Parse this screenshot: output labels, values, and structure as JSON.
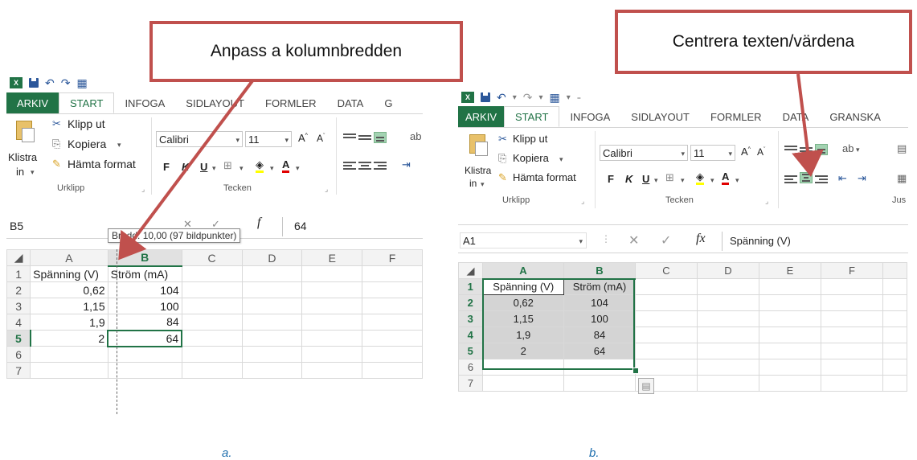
{
  "panel_a": {
    "tabs": [
      "ARKIV",
      "START",
      "INFOGA",
      "SIDLAYOUT",
      "FORMLER",
      "DATA",
      "G"
    ],
    "active_tab": "START",
    "clipboard": {
      "paste": "Klistra",
      "paste_sub": "in",
      "cut": "Klipp ut",
      "copy": "Kopiera",
      "format_painter": "Hämta format",
      "group": "Urklipp"
    },
    "font": {
      "name": "Calibri",
      "size": "11",
      "bold": "F",
      "italic": "K",
      "underline": "U",
      "group": "Tecken"
    },
    "name_box": "B5",
    "formula_value": "64",
    "tooltip": "Bredd: 10,00 (97 bildpunkter)",
    "columns": [
      "A",
      "B",
      "C",
      "D",
      "E",
      "F"
    ],
    "rows": [
      {
        "n": "1",
        "a": "Spänning (V)",
        "b": "Ström (mA)"
      },
      {
        "n": "2",
        "a": "0,62",
        "b": "104"
      },
      {
        "n": "3",
        "a": "1,15",
        "b": "100"
      },
      {
        "n": "4",
        "a": "1,9",
        "b": "84"
      },
      {
        "n": "5",
        "a": "2",
        "b": "64"
      },
      {
        "n": "6",
        "a": "",
        "b": ""
      },
      {
        "n": "7",
        "a": "",
        "b": ""
      }
    ],
    "callout": "Anpass a kolumnbredden",
    "caption": "a."
  },
  "panel_b": {
    "tabs": [
      "ARKIV",
      "START",
      "INFOGA",
      "SIDLAYOUT",
      "FORMLER",
      "DATA",
      "GRANSKA"
    ],
    "active_tab": "START",
    "clipboard": {
      "paste": "Klistra",
      "paste_sub": "in",
      "cut": "Klipp ut",
      "copy": "Kopiera",
      "format_painter": "Hämta format",
      "group": "Urklipp"
    },
    "font": {
      "name": "Calibri",
      "size": "11",
      "bold": "F",
      "italic": "K",
      "underline": "U",
      "group": "Tecken"
    },
    "align_group": "Jus",
    "name_box": "A1",
    "fx": "fx",
    "formula_value": "Spänning (V)",
    "columns": [
      "A",
      "B",
      "C",
      "D",
      "E",
      "F"
    ],
    "rows": [
      {
        "n": "1",
        "a": "Spänning (V)",
        "b": "Ström (mA)"
      },
      {
        "n": "2",
        "a": "0,62",
        "b": "104"
      },
      {
        "n": "3",
        "a": "1,15",
        "b": "100"
      },
      {
        "n": "4",
        "a": "1,9",
        "b": "84"
      },
      {
        "n": "5",
        "a": "2",
        "b": "64"
      },
      {
        "n": "6",
        "a": "",
        "b": ""
      },
      {
        "n": "7",
        "a": "",
        "b": ""
      }
    ],
    "callout": "Centrera texten/värdena",
    "caption": "b."
  },
  "colors": {
    "excel_green": "#217346",
    "callout_border": "#c0504d",
    "caption": "#1f6fae",
    "selection_fill": "#d4d4d4"
  }
}
